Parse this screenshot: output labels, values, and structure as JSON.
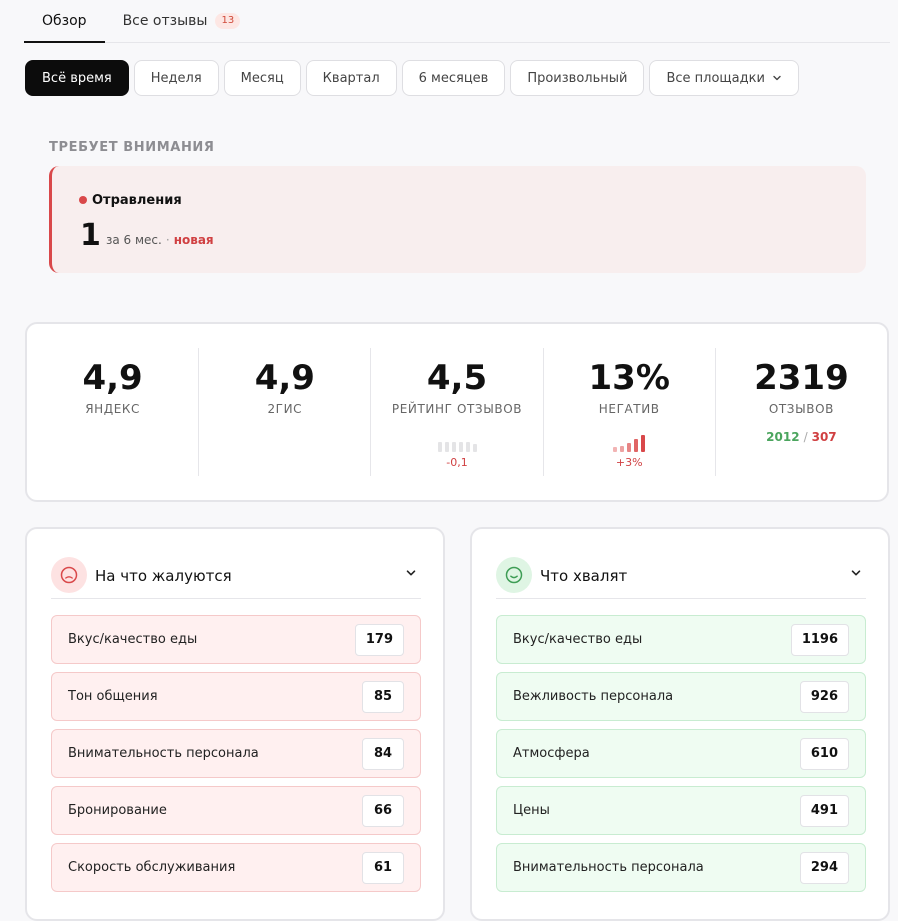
{
  "tabs": [
    {
      "label": "Обзор"
    },
    {
      "label": "Все отзывы",
      "badge": "13"
    }
  ],
  "periods": [
    "Всё время",
    "Неделя",
    "Месяц",
    "Квартал",
    "6 месяцев",
    "Произвольный"
  ],
  "platforms_select": "Все площадки",
  "attention": {
    "title": "ТРЕБУЕТ ВНИМАНИЯ",
    "item": {
      "name": "Отравления",
      "count": "1",
      "period": "за 6 мес.",
      "sep": "·",
      "status": "новая"
    }
  },
  "stats": [
    {
      "value": "4,9",
      "label": "ЯНДЕКС"
    },
    {
      "value": "4,9",
      "label": "2ГИС"
    },
    {
      "value": "4,5",
      "label": "РЕЙТИНГ ОТЗЫВОВ",
      "delta": "-0,1"
    },
    {
      "value": "13%",
      "label": "НЕГАТИВ",
      "delta": "+3%"
    },
    {
      "value": "2319",
      "label": "ОТЗЫВОВ",
      "positive": "2012",
      "slash": "/",
      "negative": "307"
    }
  ],
  "complaints": {
    "title": "На что жалуются",
    "items": [
      {
        "label": "Вкус/качество еды",
        "count": "179"
      },
      {
        "label": "Тон общения",
        "count": "85"
      },
      {
        "label": "Внимательность персонала",
        "count": "84"
      },
      {
        "label": "Бронирование",
        "count": "66"
      },
      {
        "label": "Скорость обслуживания",
        "count": "61"
      }
    ]
  },
  "praises": {
    "title": "Что хвалят",
    "items": [
      {
        "label": "Вкус/качество еды",
        "count": "1196"
      },
      {
        "label": "Вежливость персонала",
        "count": "926"
      },
      {
        "label": "Атмосфера",
        "count": "610"
      },
      {
        "label": "Цены",
        "count": "491"
      },
      {
        "label": "Внимательность персонала",
        "count": "294"
      }
    ]
  },
  "colors": {
    "accent_dark": "#0c0c0c",
    "negative": "#d04042",
    "positive": "#4ba55e"
  }
}
